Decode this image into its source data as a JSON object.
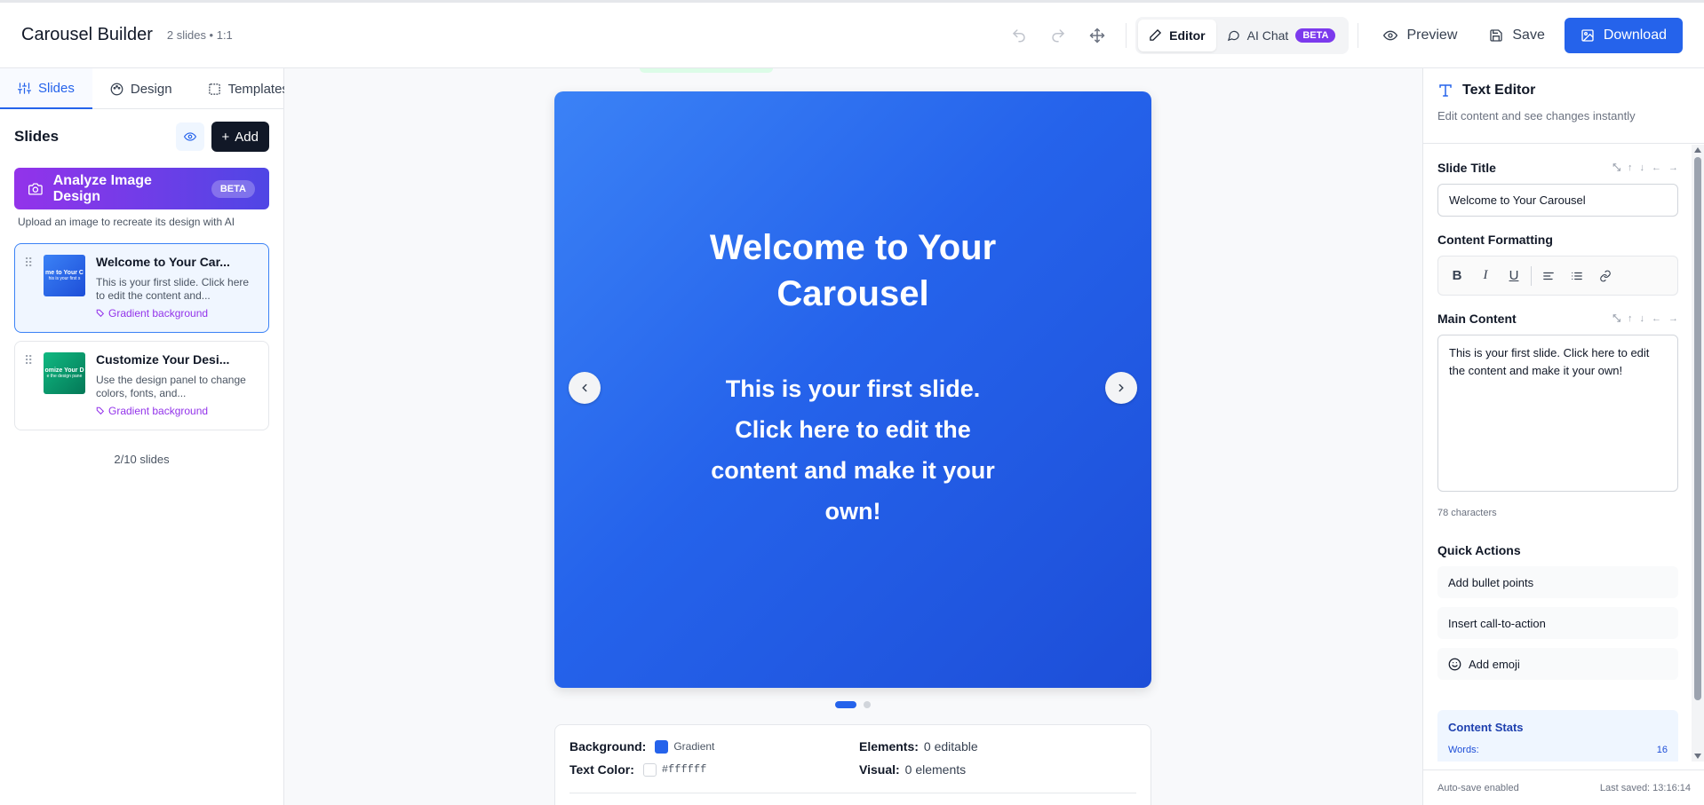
{
  "header": {
    "title": "Carousel Builder",
    "meta": "2 slides • 1:1",
    "icons": [
      "undo-icon",
      "redo-icon",
      "move-icon"
    ],
    "modes": [
      {
        "label": "Editor",
        "icon": "pencil-icon",
        "active": true
      },
      {
        "label": "AI Chat",
        "icon": "chat-icon",
        "badge": "BETA",
        "active": false
      }
    ],
    "preview_label": "Preview",
    "save_label": "Save",
    "download_label": "Download"
  },
  "sidebar": {
    "tabs": [
      {
        "label": "Slides",
        "icon": "sliders-icon",
        "active": true
      },
      {
        "label": "Design",
        "icon": "palette-icon",
        "active": false
      },
      {
        "label": "Templates",
        "icon": "template-icon",
        "active": false
      }
    ],
    "heading": "Slides",
    "add_label": "Add",
    "analyze": {
      "label": "Analyze Image Design",
      "badge": "BETA",
      "hint": "Upload an image to recreate its design with AI"
    },
    "slides": [
      {
        "title": "Welcome to Your Car...",
        "desc": "This is your first slide. Click here to edit the content and...",
        "bg": "Gradient background",
        "thumb_title": "me to Your C",
        "thumb_sub": "his is your first s",
        "color": "#2563eb"
      },
      {
        "title": "Customize Your Desi...",
        "desc": "Use the design panel to change colors, fonts, and...",
        "bg": "Gradient background",
        "thumb_title": "omize Your D",
        "thumb_sub": "e the design pane",
        "color": "#059669"
      }
    ],
    "slide_count": "2/10 slides"
  },
  "canvas": {
    "title": "Welcome to Your Carousel",
    "content": "This is your first slide. Click here to edit the content and make it your own!",
    "active_index": 0,
    "total": 2
  },
  "slide_info": {
    "background_label": "Background:",
    "background_value": "Gradient",
    "background_color": "#2563eb",
    "text_color_label": "Text Color:",
    "text_color_value": "#ffffff",
    "elements_label": "Elements:",
    "elements_value": "0 editable",
    "visual_label": "Visual:",
    "visual_value": "0 elements"
  },
  "editor": {
    "title": "Text Editor",
    "subtitle": "Edit content and see changes instantly",
    "slide_title_label": "Slide Title",
    "slide_title_value": "Welcome to Your Carousel",
    "formatting_label": "Content Formatting",
    "main_content_label": "Main Content",
    "main_content_value": "This is your first slide. Click here to edit the content and make it your own!",
    "char_count": "78 characters",
    "quick_actions_label": "Quick Actions",
    "quick_actions": [
      "Add bullet points",
      "Insert call-to-action",
      "Add emoji"
    ],
    "stats_title": "Content Stats",
    "stats_words_label": "Words:",
    "stats_words_value": "16",
    "autosave": "Auto-save enabled",
    "last_saved": "Last saved: 13:16:14"
  }
}
